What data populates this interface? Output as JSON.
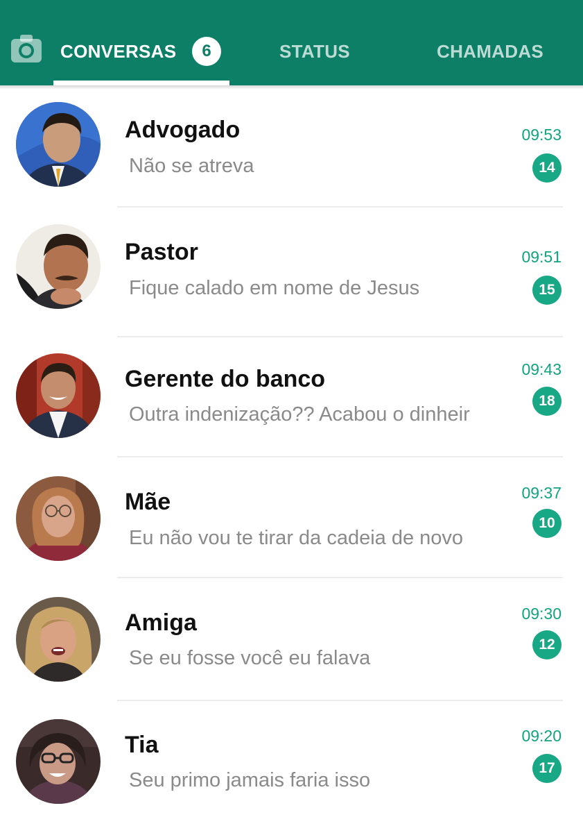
{
  "header": {
    "background_color": "#0d7f66",
    "camera_icon": "camera-icon",
    "tabs": [
      {
        "label": "CONVERSAS",
        "badge": "6",
        "active": true
      },
      {
        "label": "STATUS",
        "active": false
      },
      {
        "label": "CHAMADAS",
        "active": false
      }
    ]
  },
  "chats": [
    {
      "name": "Advogado",
      "message": "Não se atreva",
      "time": "09:53",
      "unread": "14"
    },
    {
      "name": "Pastor",
      "message": "Fique calado em nome de Jesus",
      "time": "09:51",
      "unread": "15"
    },
    {
      "name": "Gerente do banco",
      "message": "Outra indenização?? Acabou o dinheir",
      "time": "09:43",
      "unread": "18"
    },
    {
      "name": "Mãe",
      "message": "Eu não vou te tirar da cadeia de novo",
      "time": "09:37",
      "unread": "10"
    },
    {
      "name": "Amiga",
      "message": "Se eu fosse você eu falava",
      "time": "09:30",
      "unread": "12"
    },
    {
      "name": "Tia",
      "message": "Seu primo jamais faria isso",
      "time": "09:20",
      "unread": "17"
    }
  ],
  "colors": {
    "accent": "#19a886",
    "time_text": "#12a37f",
    "message_text": "#8a8a8a"
  }
}
